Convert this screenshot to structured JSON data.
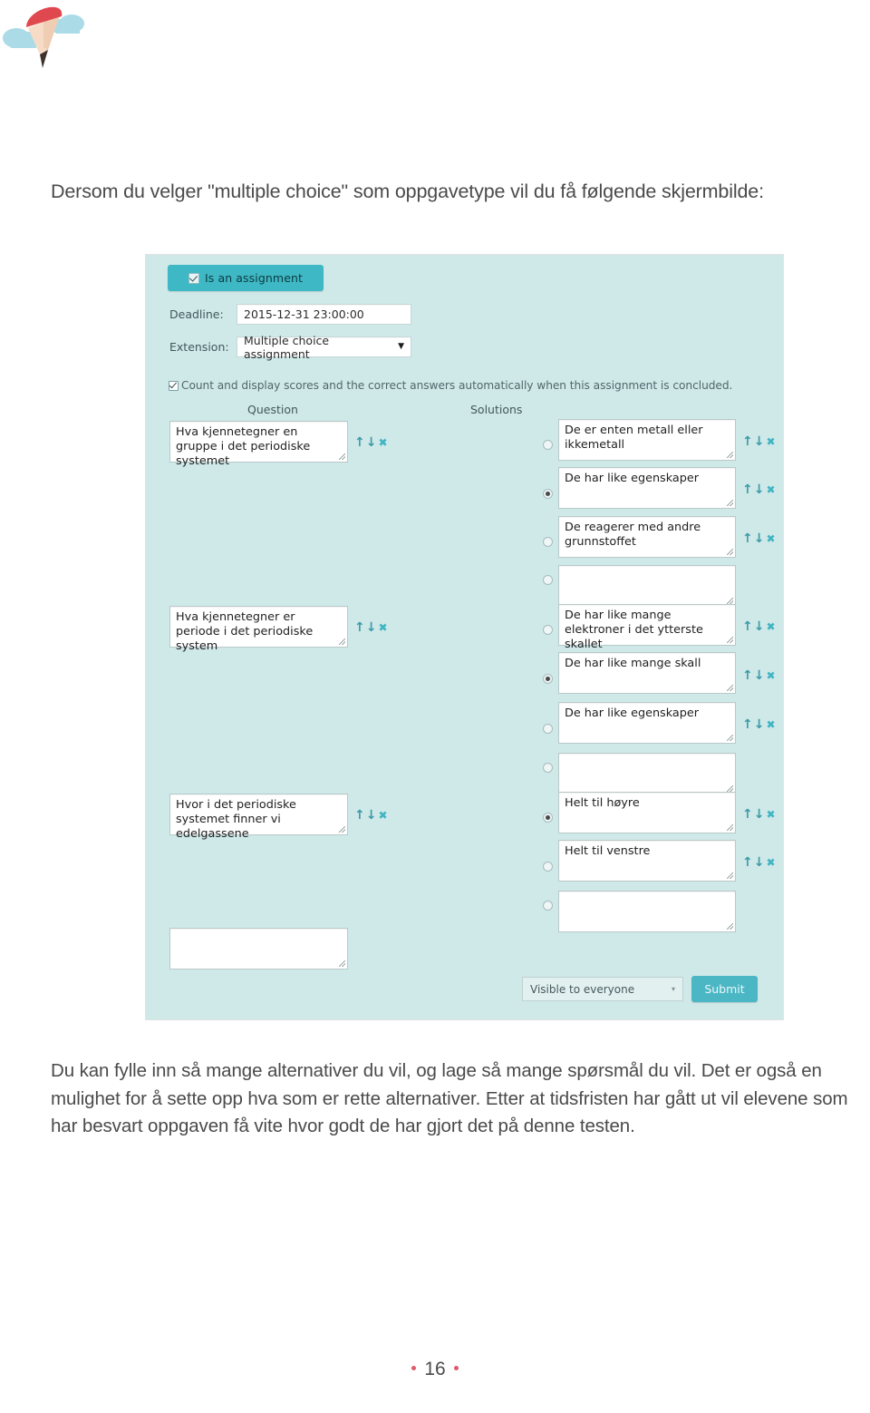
{
  "logo": {
    "name": "pencil-balloon-logo",
    "colors": {
      "cap": "#e0484f",
      "body": "#f6d9c4",
      "tip": "#3e322c",
      "cloud": "#aadbe6"
    }
  },
  "intro": {
    "text": "Dersom du velger \"multiple choice\" som oppgavetype vil du få følgende skjermbilde:"
  },
  "screenshot": {
    "assignment_toggle": {
      "label": "Is an assignment",
      "checked": true
    },
    "deadline": {
      "label": "Deadline:",
      "value": "2015-12-31 23:00:00"
    },
    "extension": {
      "label": "Extension:",
      "value": "Multiple choice assignment",
      "caret": "▼"
    },
    "auto_score": {
      "label": "Count and display scores and the correct answers automatically when this assignment is concluded.",
      "checked": true
    },
    "headers": {
      "question": "Question",
      "solutions": "Solutions"
    },
    "tools": {
      "up": "↑",
      "down": "↓",
      "remove": "✖"
    },
    "blocks": [
      {
        "question": "Hva kjennetegner en gruppe i det periodiske systemet",
        "solutions": [
          {
            "text": "De er enten metall eller ikkemetall",
            "selected": false
          },
          {
            "text": "De har like egenskaper",
            "selected": true
          },
          {
            "text": "De reagerer med andre grunnstoffet",
            "selected": false
          },
          {
            "text": "",
            "selected": false
          }
        ]
      },
      {
        "question": "Hva kjennetegner er periode i det periodiske system",
        "solutions": [
          {
            "text": "De har like mange elektroner i det ytterste skallet",
            "selected": false
          },
          {
            "text": "De har like mange skall",
            "selected": true
          },
          {
            "text": "De har like egenskaper",
            "selected": false
          },
          {
            "text": "",
            "selected": false
          }
        ]
      },
      {
        "question": "Hvor i det periodiske systemet finner vi edelgassene",
        "solutions": [
          {
            "text": "Helt til høyre",
            "selected": true
          },
          {
            "text": "Helt til venstre",
            "selected": false
          },
          {
            "text": "",
            "selected": false
          }
        ]
      }
    ],
    "new_question_placeholder": "",
    "visibility": {
      "value": "Visible to everyone",
      "caret": "▾"
    },
    "submit": {
      "label": "Submit"
    },
    "colors": {
      "panel_background": "#cfe8e8",
      "accent_teal": "#3eb8c4",
      "tool_arrow": "#3a9aa8",
      "field_background": "#ffffff"
    }
  },
  "body_copy": {
    "text": "Du kan fylle inn så mange alternativer du vil, og lage så mange spørsmål du vil. Det er også en mulighet for å sette opp hva som er rette alternativer. Etter at tidsfristen har gått ut vil elevene som har besvart oppgaven få vite hvor godt de har gjort det på denne testen."
  },
  "footer": {
    "page_number": "16"
  }
}
